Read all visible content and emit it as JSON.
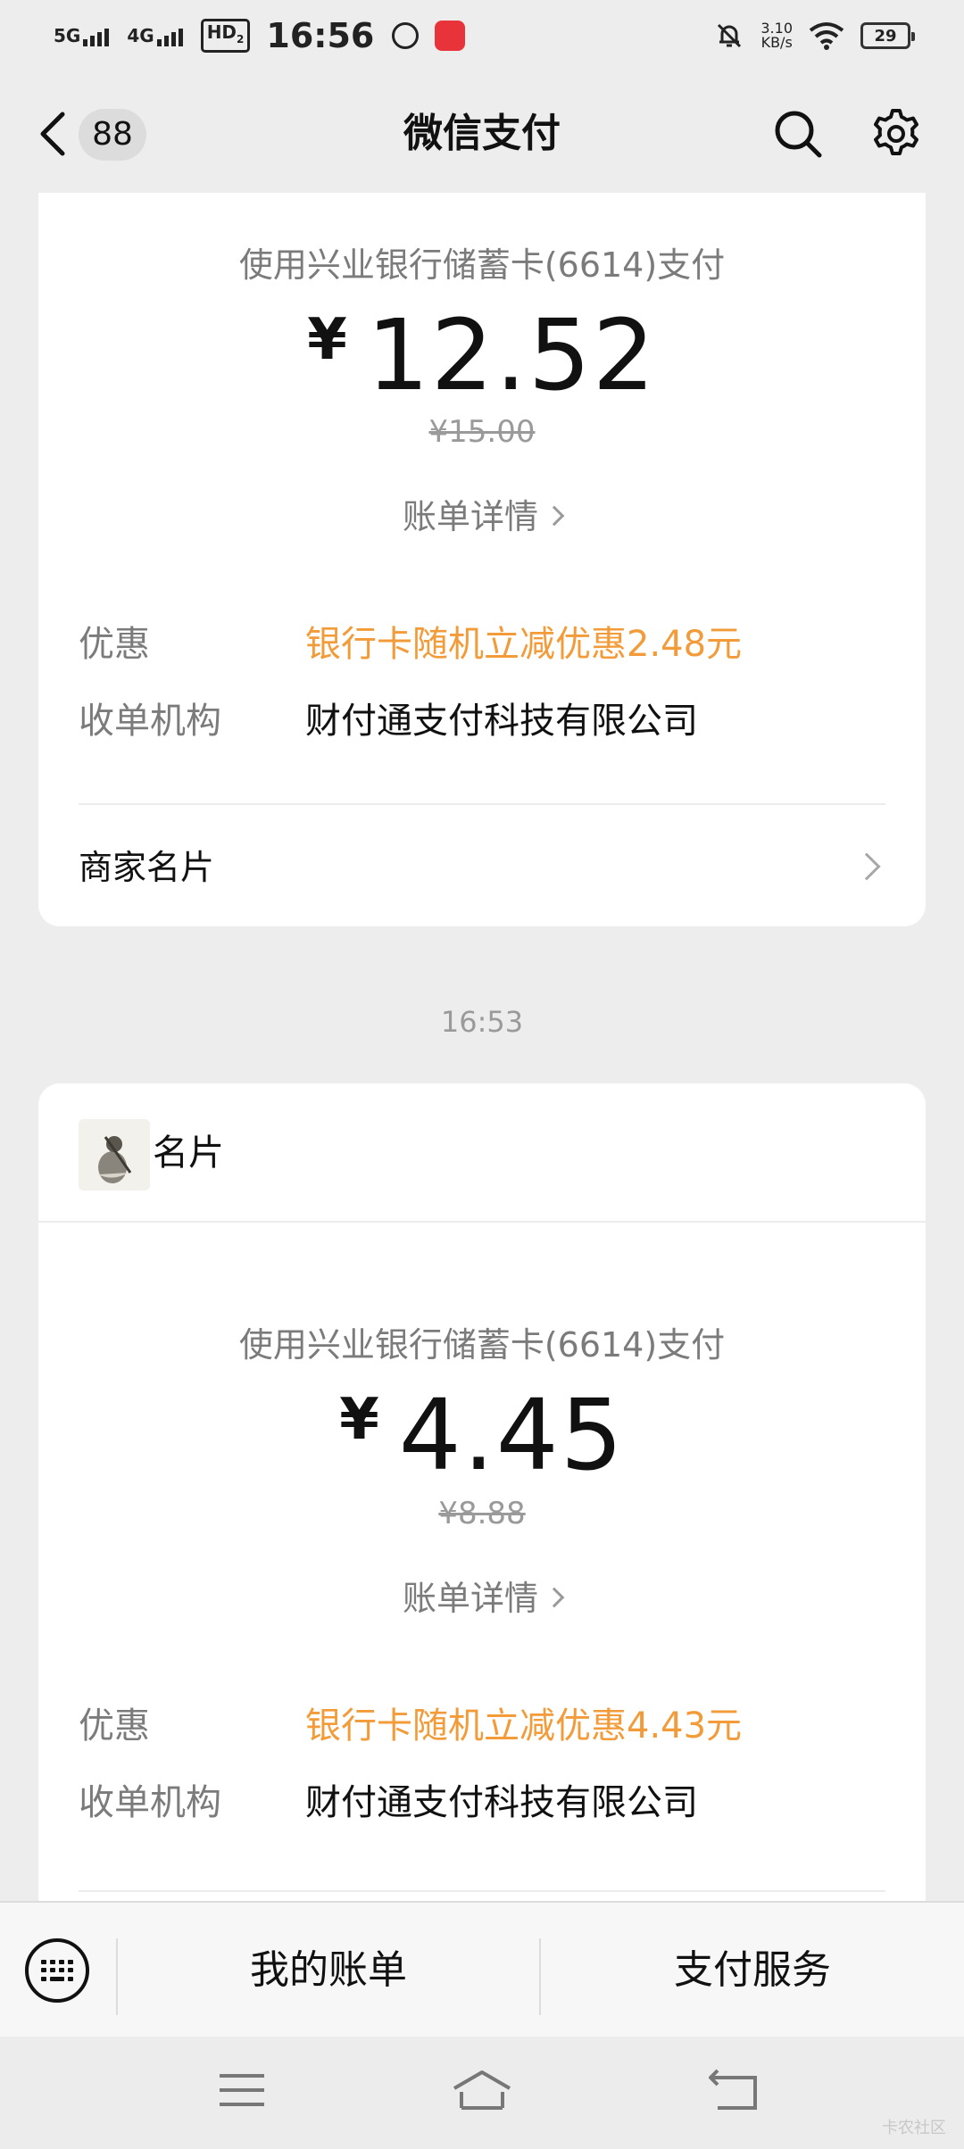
{
  "status_bar": {
    "network1": "5G",
    "network2": "4G",
    "hd": "HD",
    "hd_sub": "2",
    "time": "16:56",
    "speed_value": "3.10",
    "speed_unit": "KB/s",
    "battery": "29"
  },
  "nav": {
    "back_badge": "88",
    "title": "微信支付"
  },
  "payments": [
    {
      "method": "使用兴业银行储蓄卡(6614)支付",
      "currency": "¥",
      "amount": "12.52",
      "original": "¥15.00",
      "detail_link": "账单详情",
      "discount_label": "优惠",
      "discount_value": "银行卡随机立减优惠2.48元",
      "acquirer_label": "收单机构",
      "acquirer_value": "财付通支付科技有限公司",
      "merchant_card": "商家名片"
    },
    {
      "header_title": "名片",
      "method": "使用兴业银行储蓄卡(6614)支付",
      "currency": "¥",
      "amount": "4.45",
      "original": "¥8.88",
      "detail_link": "账单详情",
      "discount_label": "优惠",
      "discount_value": "银行卡随机立减优惠4.43元",
      "acquirer_label": "收单机构",
      "acquirer_value": "财付通支付科技有限公司"
    }
  ],
  "time_separator": "16:53",
  "bottom_menu": {
    "items": [
      "我的账单",
      "支付服务"
    ]
  },
  "watermark": "卡农社区",
  "colors": {
    "discount": "#f29b38",
    "background": "#ededed"
  }
}
